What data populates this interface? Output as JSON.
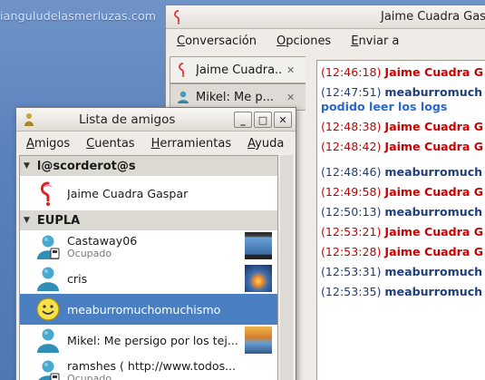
{
  "desktop": {
    "caption": "ianguludelasmerluzas.com"
  },
  "chat_window": {
    "title": "Jaime Cuadra Gas",
    "menu": [
      "Conversación",
      "Opciones",
      "Enviar a"
    ],
    "menu_underline": [
      "C",
      "O",
      "E"
    ],
    "tabs": [
      {
        "label": "Jaime Cuadra...",
        "close": "✕"
      },
      {
        "label": "Mikel: Me p...",
        "close": "✕"
      }
    ],
    "messages": [
      {
        "time": "(12:46:18)",
        "name": "Jaime Cuadra G",
        "color": "red"
      },
      {
        "time": "(12:47:51)",
        "name": "meaburromuch",
        "color": "blue",
        "cont": "podido leer los logs"
      },
      {
        "time": "(12:48:38)",
        "name": "Jaime Cuadra G",
        "color": "red"
      },
      {
        "time": "(12:48:42)",
        "name": "Jaime Cuadra G",
        "color": "red",
        "gap_after": true
      },
      {
        "time": "(12:48:46)",
        "name": "meaburromuch",
        "color": "blue"
      },
      {
        "time": "(12:49:58)",
        "name": "Jaime Cuadra G",
        "color": "red"
      },
      {
        "time": "(12:50:13)",
        "name": "meaburromuch",
        "color": "blue"
      },
      {
        "time": "(12:53:21)",
        "name": "Jaime Cuadra G",
        "color": "red"
      },
      {
        "time": "(12:53:28)",
        "name": "Jaime Cuadra G",
        "color": "red"
      },
      {
        "time": "(12:53:31)",
        "name": "meaburromuch",
        "color": "blue"
      },
      {
        "time": "(12:53:35)",
        "name": "meaburromuch",
        "color": "blue"
      }
    ]
  },
  "buddy_window": {
    "title": "Lista de amigos",
    "buttons": {
      "minimize": "_",
      "maximize": "□",
      "close": "✕"
    },
    "menu": [
      "Amigos",
      "Cuentas",
      "Herramientas",
      "Ayuda"
    ],
    "groups": [
      {
        "name": "l@scorderot@s",
        "buddies": [
          {
            "name": "Jaime Cuadra Gaspar",
            "status": "",
            "icon": "pidgin-icon"
          }
        ]
      },
      {
        "name": "EUPLA",
        "buddies": [
          {
            "name": "Castaway06",
            "status": "Ocupado",
            "icon": "msn-busy-icon",
            "thumb": "phone-avatar"
          },
          {
            "name": "cris",
            "status": "",
            "icon": "msn-user-icon",
            "thumb": "launch-avatar"
          },
          {
            "name": "meaburromuchomuchismo",
            "status": "",
            "icon": "smiley-icon",
            "selected": true
          },
          {
            "name": "Mikel: Me persigo por los tej...",
            "status": "",
            "icon": "msn-user-icon",
            "thumb": "landscape-avatar"
          },
          {
            "name": "ramshes ( http://www.todos...",
            "status": "Ocupado",
            "icon": "msn-busy-icon"
          }
        ]
      }
    ]
  },
  "colors": {
    "selection": "#4a7fc1",
    "msg_red": "#cc0000",
    "msg_blue": "#1f3f7a",
    "link_blue": "#2a67c8"
  }
}
